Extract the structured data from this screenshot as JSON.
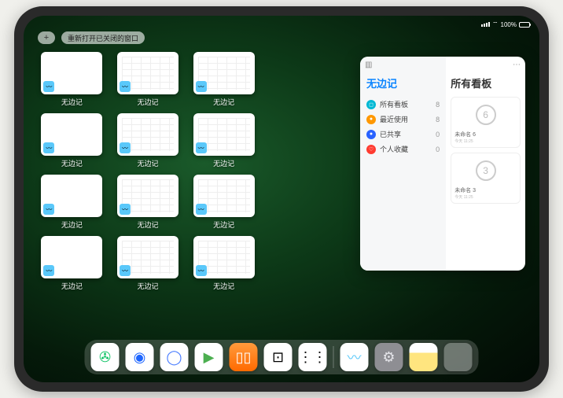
{
  "status": {
    "battery_pct": "100%"
  },
  "topbar": {
    "plus_label": "+",
    "reopen_label": "重新打开已关闭的窗口"
  },
  "thumb_label": "无边记",
  "thumbs": [
    {
      "style": "blank"
    },
    {
      "style": "grid"
    },
    {
      "style": "grid"
    },
    {
      "style": "blank"
    },
    {
      "style": "grid"
    },
    {
      "style": "grid"
    },
    {
      "style": "blank"
    },
    {
      "style": "grid"
    },
    {
      "style": "grid"
    },
    {
      "style": "blank"
    },
    {
      "style": "grid"
    },
    {
      "style": "grid"
    }
  ],
  "popover": {
    "title": "无边记",
    "right_title": "所有看板",
    "items": [
      {
        "icon_color": "#00b8d4",
        "icon": "◻",
        "label": "所有看板",
        "count": "8"
      },
      {
        "icon_color": "#ff9800",
        "icon": "●",
        "label": "最近使用",
        "count": "8"
      },
      {
        "icon_color": "#2962ff",
        "icon": "●",
        "label": "已共享",
        "count": "0"
      },
      {
        "icon_color": "#ff3b30",
        "icon": "♡",
        "label": "个人收藏",
        "count": "0"
      }
    ],
    "cards": [
      {
        "sketch": "6",
        "label": "未命名 6",
        "sub": "今天 11:25"
      },
      {
        "sketch": "3",
        "label": "未命名 3",
        "sub": "今天 11:25"
      }
    ]
  },
  "dock": [
    {
      "name": "wechat",
      "bg": "#ffffff",
      "glyph": "✇",
      "glyph_color": "#07c160"
    },
    {
      "name": "qqbrowser",
      "bg": "#ffffff",
      "glyph": "◉",
      "glyph_color": "#1e66ff"
    },
    {
      "name": "quark",
      "bg": "#ffffff",
      "glyph": "◯",
      "glyph_color": "#4a7dff"
    },
    {
      "name": "media",
      "bg": "#ffffff",
      "glyph": "▶",
      "glyph_color": "#4caf50"
    },
    {
      "name": "books",
      "bg": "linear-gradient(#ff9a3c,#ff6a00)",
      "glyph": "▯▯",
      "glyph_color": "#fff"
    },
    {
      "name": "dice",
      "bg": "#ffffff",
      "glyph": "⊡",
      "glyph_color": "#000"
    },
    {
      "name": "nodes",
      "bg": "#ffffff",
      "glyph": "⋮⋮",
      "glyph_color": "#000"
    },
    {
      "sep": true
    },
    {
      "name": "freeform",
      "bg": "#ffffff",
      "glyph": "〰",
      "glyph_color": "#5ac8fa"
    },
    {
      "name": "settings",
      "bg": "#8e8e93",
      "glyph": "⚙",
      "glyph_color": "#e5e5ea"
    },
    {
      "name": "notes",
      "bg": "linear-gradient(#fff 35%,#ffe57f 35%)",
      "glyph": "",
      "glyph_color": "#000"
    },
    {
      "folder": true,
      "name": "app-folder",
      "cells": [
        "#4cd964",
        "#ff9500",
        "#5ac8fa",
        "#007aff"
      ]
    }
  ]
}
